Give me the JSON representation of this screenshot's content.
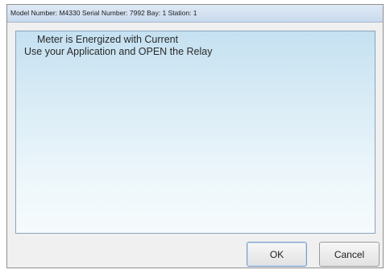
{
  "window": {
    "title": "Model Number: M4330  Serial Number: 7992  Bay: 1  Station: 1"
  },
  "message": {
    "line1": "Meter is Energized with Current",
    "line2": "Use your Application and OPEN the Relay"
  },
  "buttons": {
    "ok_label": "OK",
    "cancel_label": "Cancel"
  }
}
